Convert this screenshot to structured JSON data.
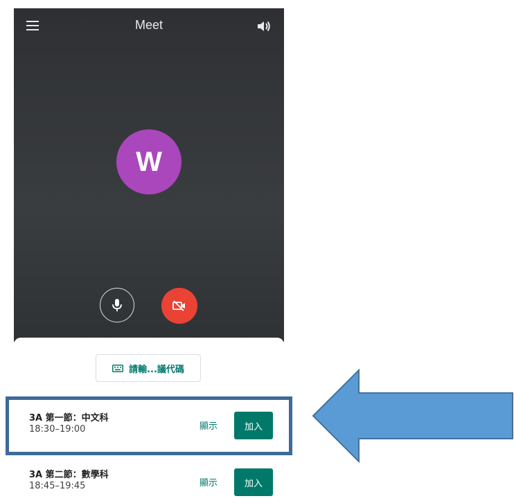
{
  "topbar": {
    "title": "Meet",
    "menu_icon": "hamburger-menu-icon",
    "speaker_icon": "speaker-volume-icon"
  },
  "preview": {
    "avatar_letter": "W",
    "mic_icon": "microphone-icon",
    "camera_icon": "camera-off-icon"
  },
  "sheet": {
    "enter_code_label": "請輸...議代碼",
    "keyboard_icon": "keyboard-icon"
  },
  "meetings": [
    {
      "title": "3A 第一節：中文科",
      "time": "18:30–19:00",
      "show_label": "顯示",
      "join_label": "加入"
    },
    {
      "title": "3A 第二節：數學科",
      "time": "18:45–19:45",
      "show_label": "顯示",
      "join_label": "加入"
    }
  ],
  "annotation": {
    "arrow_icon": "left-pointing-arrow",
    "arrow_color": "#5b9bd5",
    "highlight_color": "#3d6a99"
  },
  "colors": {
    "accent": "#00796b",
    "avatar": "#ab47bc",
    "camera_off": "#ea4335"
  }
}
